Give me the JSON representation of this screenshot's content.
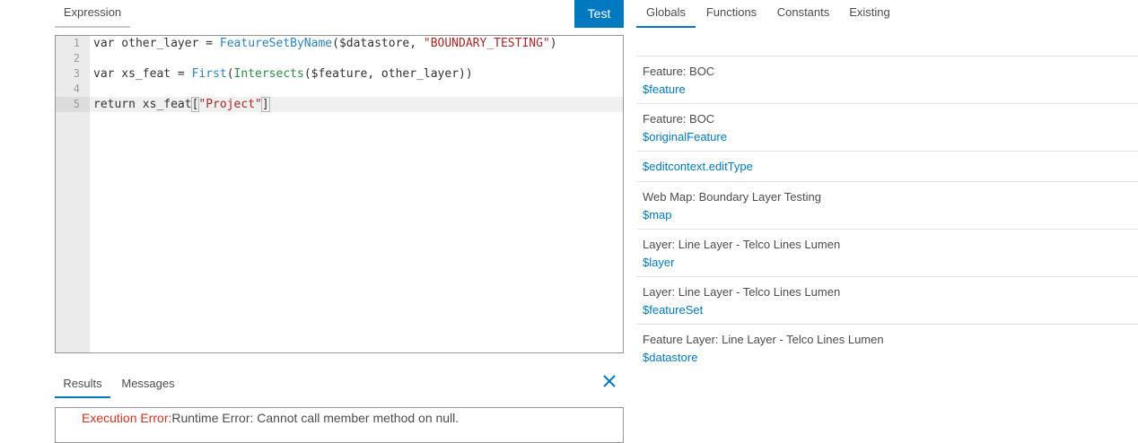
{
  "left_tabs": {
    "expression": "Expression"
  },
  "test_button": "Test",
  "editor": {
    "lines": [
      {
        "num": "1",
        "parts": [
          {
            "t": "var other_layer = ",
            "c": "kw"
          },
          {
            "t": "FeatureSetByName",
            "c": "fn"
          },
          {
            "t": "($datastore, ",
            "c": "kw"
          },
          {
            "t": "\"BOUNDARY_TESTING\"",
            "c": "str"
          },
          {
            "t": ")",
            "c": "kw"
          }
        ]
      },
      {
        "num": "2",
        "parts": []
      },
      {
        "num": "3",
        "parts": [
          {
            "t": "var xs_feat = ",
            "c": "kw"
          },
          {
            "t": "First",
            "c": "fn"
          },
          {
            "t": "(",
            "c": "kw"
          },
          {
            "t": "Intersects",
            "c": "fn2"
          },
          {
            "t": "($feature, other_layer))",
            "c": "kw"
          }
        ]
      },
      {
        "num": "4",
        "parts": []
      },
      {
        "num": "5",
        "parts": [
          {
            "t": "return xs_feat",
            "c": "kw"
          },
          {
            "t": "[",
            "c": "kw cursor-bracket"
          },
          {
            "t": "\"Project\"",
            "c": "str"
          },
          {
            "t": "]",
            "c": "kw cursor-bracket"
          }
        ]
      }
    ],
    "active_line": "5"
  },
  "results": {
    "tabs": {
      "results": "Results",
      "messages": "Messages"
    },
    "active_tab": "results",
    "error_label": "Execution Error:",
    "error_message": "Runtime Error: Cannot call member method on null."
  },
  "right_tabs": {
    "globals": "Globals",
    "functions": "Functions",
    "constants": "Constants",
    "existing": "Existing",
    "active": "globals"
  },
  "globals": [
    {
      "label": "Feature: BOC",
      "value": "$feature"
    },
    {
      "label": "Feature: BOC",
      "value": "$originalFeature"
    },
    {
      "label": "",
      "value": "$editcontext.editType"
    },
    {
      "label": "Web Map: Boundary Layer Testing",
      "value": "$map"
    },
    {
      "label": "Layer: Line Layer - Telco Lines Lumen",
      "value": "$layer"
    },
    {
      "label": "Layer: Line Layer - Telco Lines Lumen",
      "value": "$featureSet"
    },
    {
      "label": "Feature Layer: Line Layer - Telco Lines Lumen",
      "value": "$datastore"
    }
  ],
  "colors": {
    "accent": "#0079c1",
    "error": "#d83020"
  },
  "icons": {
    "close": "close-icon"
  }
}
